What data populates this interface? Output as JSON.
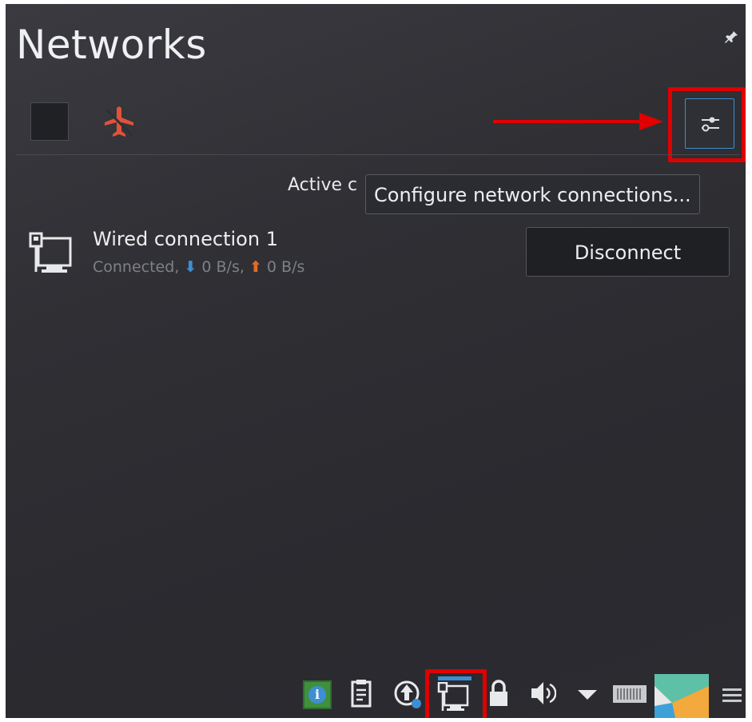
{
  "panel": {
    "title": "Networks",
    "section_header": "Active c",
    "tooltip": "Configure network connections..."
  },
  "connection": {
    "name": "Wired connection 1",
    "status_prefix": "Connected,",
    "download": "0 B/s,",
    "upload": "0 B/s",
    "disconnect_label": "Disconnect"
  },
  "colors": {
    "accent": "#3d8fd1",
    "highlight": "#e00000",
    "airplane": "#e0533a",
    "upload": "#e06a2b"
  },
  "icons": {
    "pin": "pin-icon",
    "airplane": "airplane-mode-icon",
    "configure": "configure-icon",
    "wired": "wired-network-icon",
    "tray": [
      "info-icon",
      "clipboard-icon",
      "updates-icon",
      "network-icon",
      "lock-icon",
      "volume-icon",
      "chevron-down-icon",
      "keyboard-layout-icon",
      "kde-logo-icon",
      "hamburger-menu-icon"
    ]
  },
  "tray_info_glyph": "i"
}
